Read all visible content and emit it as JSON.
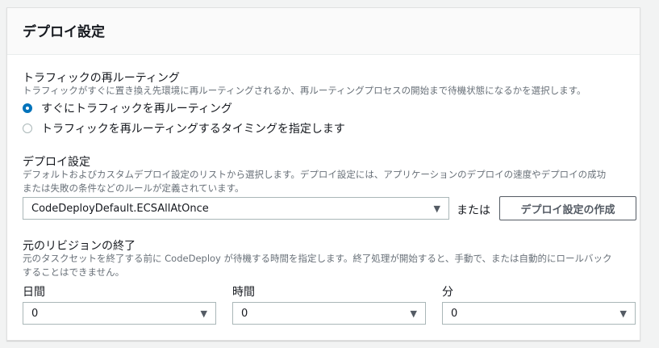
{
  "title": "デプロイ設定",
  "traffic": {
    "label": "トラフィックの再ルーティング",
    "desc": "トラフィックがすぐに置き換え先環境に再ルーティングされるか、再ルーティングプロセスの開始まで待機状態になるかを選択します。",
    "options": [
      {
        "label": "すぐにトラフィックを再ルーティング",
        "selected": true
      },
      {
        "label": "トラフィックを再ルーティングするタイミングを指定します",
        "selected": false
      }
    ]
  },
  "config": {
    "label": "デプロイ設定",
    "desc1": "デフォルトおよびカスタムデプロイ設定のリストから選択します。デプロイ設定には、アプリケーションのデプロイの速度やデプロイの成功",
    "desc2": "または失敗の条件などのルールが定義されています。",
    "value": "CodeDeployDefault.ECSAllAtOnce",
    "or": "または",
    "create_button": "デプロイ設定の作成"
  },
  "termination": {
    "label": "元のリビジョンの終了",
    "desc1": "元のタスクセットを終了する前に CodeDeploy が待機する時間を指定します。終了処理が開始すると、手動で、または自動的にロールバック",
    "desc2": "することはできません。",
    "fields": [
      {
        "label": "日間",
        "value": "0"
      },
      {
        "label": "時間",
        "value": "0"
      },
      {
        "label": "分",
        "value": "0"
      }
    ]
  }
}
